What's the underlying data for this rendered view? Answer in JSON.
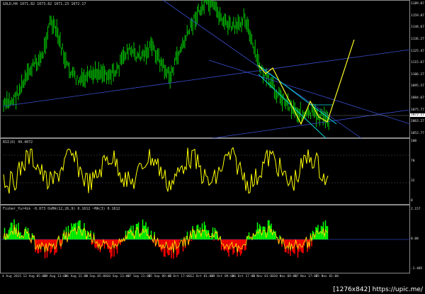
{
  "main_pane": {
    "label": "GOLD,H4  1071.82 1073.82 1071.23 1072.17",
    "price_ticks": [
      "1189.07",
      "1159.87",
      "1148.67",
      "1136.27",
      "1125.47",
      "1115.67",
      "1106.27",
      "1095.57",
      "1084.67",
      "1075.77",
      "1063.27",
      "1052.77"
    ],
    "current_price": "1072.17"
  },
  "rsi_pane": {
    "label": "RSI(8) 49.4072",
    "ticks": [
      "100",
      "70",
      "32",
      "0"
    ]
  },
  "fisher_pane": {
    "label": "Fisher_Yur4ik -0.073 OsMA(12,26,9) 0.1612 ~MA(3) 0.1612",
    "ticks": [
      "2.157",
      "0.00",
      "-2.405"
    ]
  },
  "time_axis": [
    "4 Aug 2015",
    "12 Aug 05:00",
    "19 Aug 13:00",
    "26 Aug 21:00",
    "3 Sep 05:00",
    "10 Sep 13:00",
    "17 Sep 21:00",
    "25 Sep 09:00",
    "2 Oct 17:00",
    "12 Oct 01:00",
    "19 Oct 09:00",
    "26 Oct 17:00",
    "3 Nov 01:00",
    "10 Nov 09:00",
    "17 Nov 17:00",
    "25 Nov 01:00"
  ],
  "watermark": "[1276x842] https://upic.me/",
  "colors": {
    "candles": "#00c800",
    "rsi": "#ffff00",
    "hist_positive": "#00ff00",
    "hist_negative": "#ff0000",
    "signal": "#ffd700",
    "trend_lines": "#3a4fd0",
    "channel": "#00d8d8",
    "zigzag": "#ffff20"
  }
}
